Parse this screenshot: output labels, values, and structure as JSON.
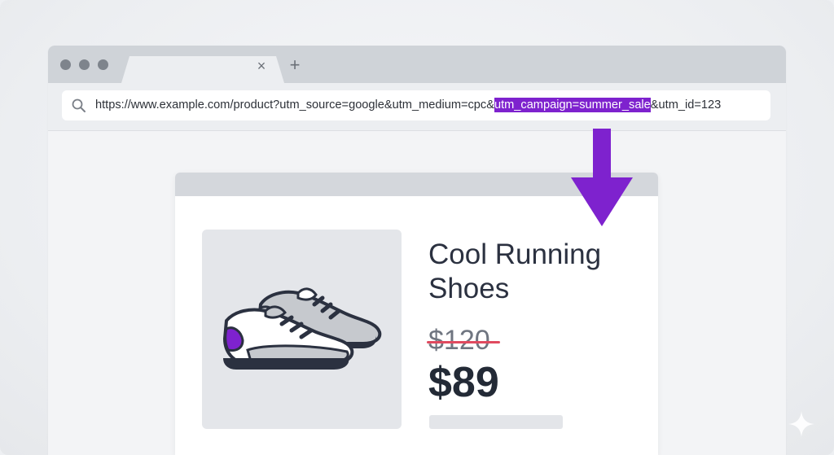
{
  "browser": {
    "url_prefix": "https://www.example.com/product?utm_source=google&utm_medium=cpc&",
    "url_highlight": "utm_campaign=summer_sale",
    "url_suffix": "&utm_id=123",
    "tab_close_glyph": "×",
    "new_tab_glyph": "+",
    "highlight_color": "#7e22ce"
  },
  "product": {
    "title": "Cool Running Shoes",
    "old_price": "$120",
    "new_price": "$89"
  },
  "icons": {
    "search": "search-icon",
    "arrow": "arrow-down-icon",
    "shoes": "sneakers-icon",
    "sparkle": "sparkle-icon"
  },
  "colors": {
    "accent": "#7e22ce",
    "strike": "#e04a5f"
  }
}
